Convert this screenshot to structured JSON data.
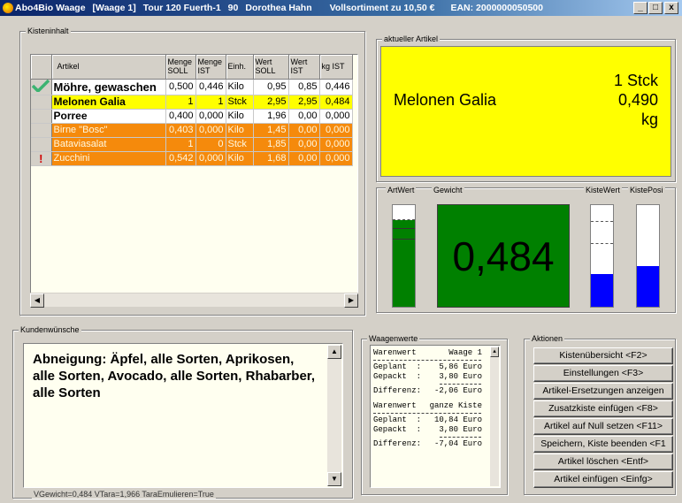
{
  "title": {
    "app": "Abo4Bio Waage",
    "station": "[Waage 1]",
    "tour": "Tour 120 Fuerth-1",
    "number": "90",
    "customer": "Dorothea Hahn",
    "assortment": "Vollsortiment zu 10,50 €",
    "ean": "EAN: 2000000050500",
    "minimize": "_",
    "maximize": "□",
    "close": "x"
  },
  "box": {
    "legend": "Kisteninhalt",
    "columns": [
      "Artikel",
      "Menge SOLL",
      "Menge IST",
      "Einh.",
      "Wert SOLL",
      "Wert IST",
      "kg IST"
    ],
    "rows": [
      {
        "mark": "✔",
        "article": "Möhre, gewaschen",
        "qty_target": "0,500",
        "qty_actual": "0,446",
        "unit": "Kilo",
        "value_target": "0,95",
        "value_actual": "0,85",
        "kg": "0,446"
      },
      {
        "mark": "",
        "article": "Melonen Galia",
        "qty_target": "1",
        "qty_actual": "1",
        "unit": "Stck",
        "value_target": "2,95",
        "value_actual": "2,95",
        "kg": "0,484"
      },
      {
        "mark": "",
        "article": "Porree",
        "qty_target": "0,400",
        "qty_actual": "0,000",
        "unit": "Kilo",
        "value_target": "1,96",
        "value_actual": "0,00",
        "kg": "0,000"
      },
      {
        "mark": "",
        "article": "Birne \"Bosc\"",
        "qty_target": "0,403",
        "qty_actual": "0,000",
        "unit": "Kilo",
        "value_target": "1,45",
        "value_actual": "0,00",
        "kg": "0,000"
      },
      {
        "mark": "",
        "article": "Bataviasalat",
        "qty_target": "1",
        "qty_actual": "0",
        "unit": "Stck",
        "value_target": "1,85",
        "value_actual": "0,00",
        "kg": "0,000"
      },
      {
        "mark": "!",
        "article": "Zucchini",
        "qty_target": "0,542",
        "qty_actual": "0,000",
        "unit": "Kilo",
        "value_target": "1,68",
        "value_actual": "0,00",
        "kg": "0,000"
      }
    ],
    "scroll_left": "◀",
    "scroll_right": "▶"
  },
  "current_article": {
    "legend": "aktueller Artikel",
    "name": "Melonen Galia",
    "quantity": "1 Stck",
    "weight": "0,490",
    "weight_unit": "kg"
  },
  "gauges": {
    "art_value_legend": "ArtWert",
    "weight_legend": "Gewicht",
    "box_value_legend": "KisteWert",
    "box_position_legend": "KistePosi",
    "weight_display": "0,484",
    "art_value_level": 0.85,
    "box_value_level": 0.32,
    "box_position_level": 0.4,
    "colors": {
      "green": "#008000",
      "blue": "#0000ff"
    }
  },
  "wishes": {
    "legend": "Kundenwünsche",
    "text": "Abneigung: Äpfel, alle Sorten, Aprikosen, alle Sorten, Avocado, alle Sorten, Rhabarber, alle Sorten",
    "scroll_up": "▲",
    "scroll_down": "▼"
  },
  "scale_values": {
    "legend": "Waagenwerte",
    "block1_label": "Warenwert",
    "block1_scope": "Waage 1",
    "block1_planned_label": "Geplant  :",
    "block1_planned": "5,86 Euro",
    "block1_packed_label": "Gepackt  :",
    "block1_packed": "3,80 Euro",
    "block1_diff_label": "Differenz:",
    "block1_diff": "-2,06 Euro",
    "block2_label": "Warenwert",
    "block2_scope": "ganze Kiste",
    "block2_planned_label": "Geplant  :",
    "block2_planned": "10,84 Euro",
    "block2_packed_label": "Gepackt  :",
    "block2_packed": "3,80 Euro",
    "block2_diff_label": "Differenz:",
    "block2_diff": "-7,04 Euro"
  },
  "actions": {
    "legend": "Aktionen",
    "buttons": [
      "Kistenübersicht <F2>",
      "Einstellungen <F3>",
      "Artikel-Ersetzungen anzeigen",
      "Zusatzkiste einfügen <F8>",
      "Artikel auf Null setzen <F11>",
      "Speichern, Kiste beenden <F1",
      "Artikel löschen <Entf>",
      "Artikel einfügen <Einfg>"
    ]
  },
  "status_bar": "VGewicht=0,484  VTara=1,966  TaraEmulieren=True"
}
